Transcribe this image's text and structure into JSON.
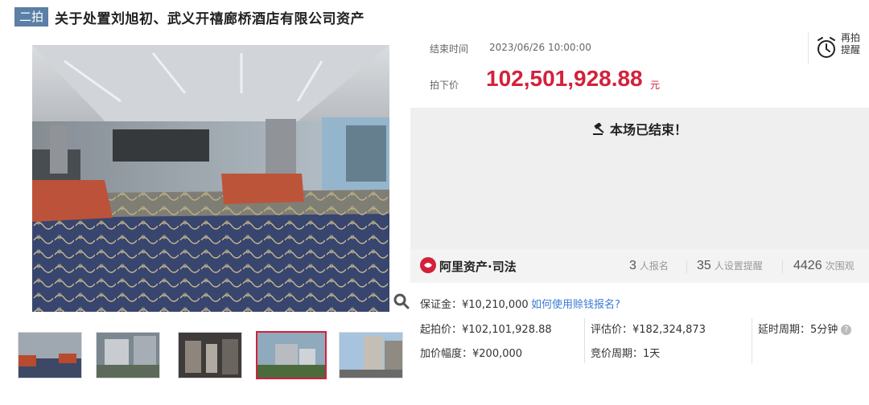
{
  "header": {
    "badge": "二拍",
    "title": "关于处置刘旭初、武义开禧廊桥酒店有限公司资产"
  },
  "auction": {
    "end_time_label": "结束时间",
    "end_time_value": "2023/06/26 10:00:00",
    "price_label": "拍下价",
    "price_value": "102,501,928.88",
    "price_unit": "元",
    "remind_label": "再拍提醒",
    "status_text": "本场已结束！"
  },
  "brand": {
    "name": "阿里资产·司法",
    "signups_count": "3",
    "signups_label": "人报名",
    "reminders_count": "35",
    "reminders_label": "人设置提醒",
    "views_count": "4426",
    "views_label": "次围观"
  },
  "details": {
    "deposit": "保证金：¥10,210,000",
    "deposit_link": "如何使用赊钱报名?",
    "start_price": "起拍价：¥102,101,928.88",
    "appraisal": "评估价：¥182,324,873",
    "delay_period": "延时周期：5分钟",
    "increment": "加价幅度：¥200,000",
    "bid_period": "竞价周期：1天"
  },
  "colors": {
    "accent_red": "#d3213c",
    "badge_blue": "#5b7fa6",
    "link_blue": "#3a7bd5"
  },
  "icons": [
    "alarm-clock-icon",
    "gavel-icon",
    "magnifier-icon",
    "alibaba-logo-icon",
    "help-icon"
  ],
  "thumbnails": [
    "thumb-ballroom",
    "thumb-aerial-view",
    "thumb-lobby",
    "thumb-building-exterior",
    "thumb-street-view"
  ]
}
